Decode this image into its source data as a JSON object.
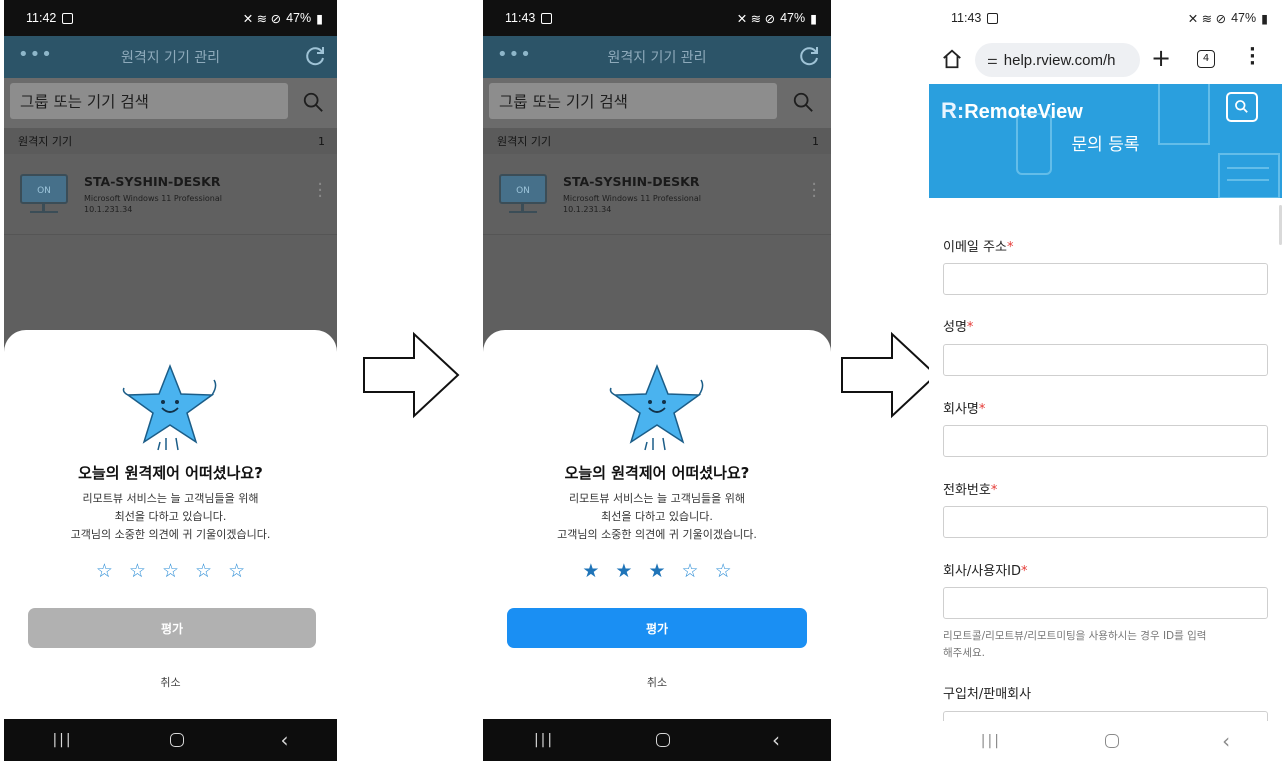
{
  "panel1": {
    "status_time": "11:42",
    "status_battery": "47%",
    "app_title": "원격지 기기 관리",
    "search_placeholder": "그룹 또는 기기 검색",
    "section_label": "원격지 기기",
    "section_count": "1",
    "device": {
      "state": "ON",
      "name": "STA-SYSHIN-DESKR",
      "os": "Microsoft Windows 11 Professional",
      "ip": "10.1.231.34"
    },
    "rating": {
      "question": "오늘의 원격제어 어떠셨나요?",
      "desc_line1": "리모트뷰 서비스는 늘 고객님들을 위해",
      "desc_line2": "최선을 다하고 있습니다.",
      "desc_line3": "고객님의 소중한 의견에 귀 기울이겠습니다.",
      "stars_selected": 0,
      "stars_total": 5,
      "submit_label": "평가",
      "cancel_label": "취소"
    }
  },
  "panel2": {
    "status_time": "11:43",
    "status_battery": "47%",
    "app_title": "원격지 기기 관리",
    "search_placeholder": "그룹 또는 기기 검색",
    "section_label": "원격지 기기",
    "section_count": "1",
    "device": {
      "state": "ON",
      "name": "STA-SYSHIN-DESKR",
      "os": "Microsoft Windows 11 Professional",
      "ip": "10.1.231.34"
    },
    "rating": {
      "question": "오늘의 원격제어 어떠셨나요?",
      "desc_line1": "리모트뷰 서비스는 늘 고객님들을 위해",
      "desc_line2": "최선을 다하고 있습니다.",
      "desc_line3": "고객님의 소중한 의견에 귀 기울이겠습니다.",
      "stars_selected": 3,
      "stars_total": 5,
      "submit_label": "평가",
      "cancel_label": "취소"
    }
  },
  "panel3": {
    "status_time": "11:43",
    "status_battery": "47%",
    "url": "help.rview.com/h",
    "tab_count": "4",
    "brand": "RemoteView",
    "brand_mark": "R:",
    "page_title": "문의 등록",
    "fields": [
      {
        "label": "이메일 주소",
        "required": "*"
      },
      {
        "label": "성명",
        "required": "*"
      },
      {
        "label": "회사명",
        "required": "*"
      },
      {
        "label": "전화번호",
        "required": "*"
      },
      {
        "label": "회사/사용자ID",
        "required": "*"
      },
      {
        "label": "구입처/판매회사",
        "required": ""
      }
    ],
    "id_help_line1": "리모트콜/리모트뷰/리모트미팅을 사용하시는 경우 ID를 입력",
    "id_help_line2": "해주세요."
  },
  "colors": {
    "appbar": "#2c5468",
    "accent_blue": "#1a8ff3",
    "hero_blue": "#2a9fde",
    "star_blue": "#1f74b8",
    "required_red": "#e53935"
  }
}
